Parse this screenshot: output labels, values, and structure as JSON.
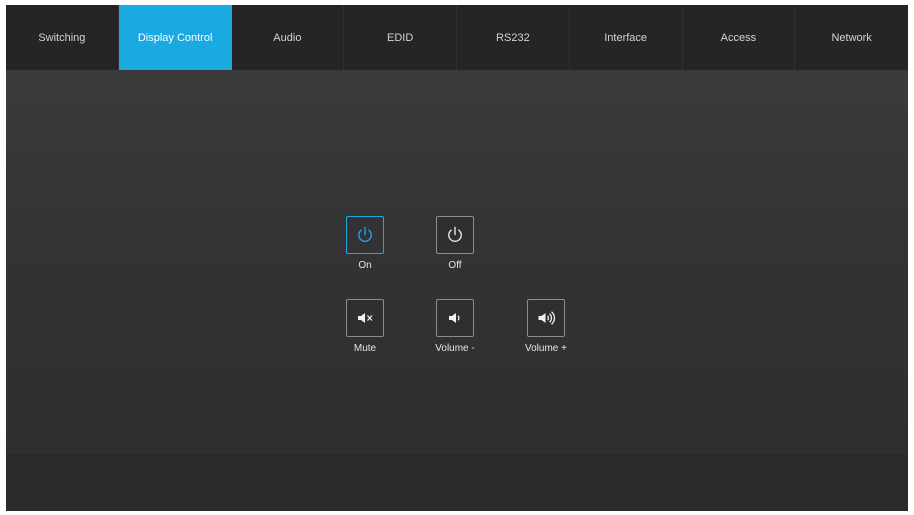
{
  "tabs": [
    {
      "label": "Switching"
    },
    {
      "label": "Display Control"
    },
    {
      "label": "Audio"
    },
    {
      "label": "EDID"
    },
    {
      "label": "RS232"
    },
    {
      "label": "Interface"
    },
    {
      "label": "Access"
    },
    {
      "label": "Network"
    }
  ],
  "active_tab": "Display Control",
  "colors": {
    "accent": "#1aa9e0",
    "background": "#2b2b2d"
  },
  "controls": {
    "on": {
      "label": "On",
      "icon": "power-icon"
    },
    "off": {
      "label": "Off",
      "icon": "power-icon"
    },
    "mute": {
      "label": "Mute",
      "icon": "volume-mute-icon"
    },
    "volume_down": {
      "label": "Volume -",
      "icon": "volume-down-icon"
    },
    "volume_up": {
      "label": "Volume +",
      "icon": "volume-up-icon"
    }
  }
}
